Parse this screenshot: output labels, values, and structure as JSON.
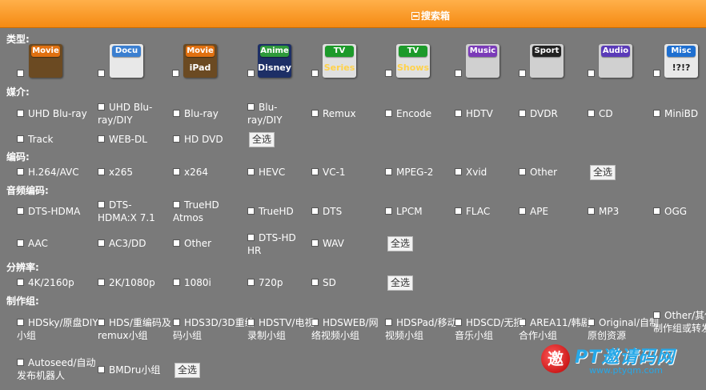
{
  "header": {
    "title": "搜索箱"
  },
  "sections": {
    "type": "类型:",
    "medium": "媒介:",
    "codec": "编码:",
    "audio": "音频编码:",
    "resolution": "分辨率:",
    "group": "制作组:"
  },
  "type_icons": [
    {
      "tag": "Movie",
      "sub": "",
      "icon": "film-reel-icon"
    },
    {
      "tag": "Docu",
      "sub": "",
      "icon": "atom-icon"
    },
    {
      "tag": "Movie",
      "sub": "iPad",
      "icon": "ipad-icon"
    },
    {
      "tag": "Anime",
      "sub": "Disney",
      "icon": "disney-icon"
    },
    {
      "tag": "TV",
      "sub": "Series",
      "icon": "tv-series-icon"
    },
    {
      "tag": "TV",
      "sub": "Shows",
      "icon": "tv-shows-icon"
    },
    {
      "tag": "Music",
      "sub": "",
      "icon": "mtv-icon"
    },
    {
      "tag": "Sport",
      "sub": "",
      "icon": "nhl-icon"
    },
    {
      "tag": "Audio",
      "sub": "",
      "icon": "dolby-icon"
    },
    {
      "tag": "Misc",
      "sub": "!?!?",
      "icon": "misc-icon"
    }
  ],
  "medium": [
    "UHD Blu-ray",
    "UHD Blu-ray/DIY",
    "Blu-ray",
    "Blu-ray/DIY",
    "Remux",
    "Encode",
    "HDTV",
    "DVDR",
    "CD",
    "MiniBD",
    "Track",
    "WEB-DL",
    "HD DVD"
  ],
  "codec": [
    "H.264/AVC",
    "x265",
    "x264",
    "HEVC",
    "VC-1",
    "MPEG-2",
    "Xvid",
    "Other"
  ],
  "audio": [
    "DTS-HDMA",
    "DTS-HDMA:X 7.1",
    "TrueHD Atmos",
    "TrueHD",
    "DTS",
    "LPCM",
    "FLAC",
    "APE",
    "MP3",
    "OGG",
    "AAC",
    "AC3/DD",
    "Other",
    "DTS-HD HR",
    "WAV"
  ],
  "resolution": [
    "4K/2160p",
    "2K/1080p",
    "1080i",
    "720p",
    "SD"
  ],
  "group": [
    "HDSky/原盘DIY小组",
    "HDS/重编码及remux小组",
    "HDS3D/3D重编码小组",
    "HDSTV/电视录制小组",
    "HDSWEB/网络视频小组",
    "HDSPad/移动视频小组",
    "HDSCD/无损音乐小组",
    "AREA11/韩剧合作小组",
    "Original/自制原创资源",
    "Other/其他制作组或转发源",
    "Autoseed/自动发布机器人",
    "BMDru小组"
  ],
  "select_all": "全选",
  "watermark": {
    "mark": "邀",
    "title": "PT邀请码网",
    "url": "www.ptyqm.com"
  }
}
